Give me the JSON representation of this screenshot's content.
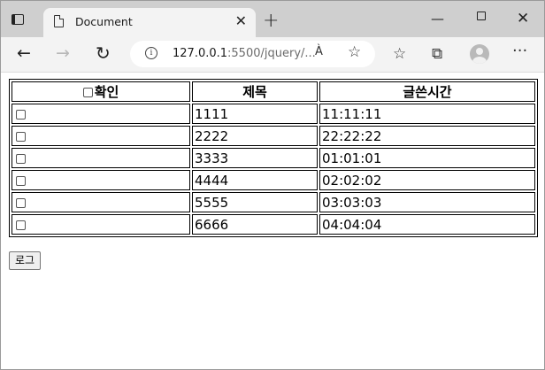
{
  "browser": {
    "tab_title": "Document",
    "url_host": "127.0.0.1",
    "url_rest": ":5500/jquery/...",
    "read_aloud_label": "À",
    "icons": [
      "sidebar-toggle-icon",
      "document-icon",
      "close-icon",
      "plus-icon",
      "minimize-icon",
      "maximize-icon",
      "window-close-icon",
      "back-icon",
      "forward-icon",
      "reload-icon",
      "info-icon",
      "read-aloud-icon",
      "add-favorite-icon",
      "favorites-icon",
      "collections-icon",
      "profile-icon",
      "more-icon"
    ]
  },
  "table": {
    "headers": [
      "확인",
      "제목",
      "글쓴시간"
    ],
    "rows": [
      {
        "title": "1111",
        "time": "11:11:11"
      },
      {
        "title": "2222",
        "time": "22:22:22"
      },
      {
        "title": "3333",
        "time": "01:01:01"
      },
      {
        "title": "4444",
        "time": "02:02:02"
      },
      {
        "title": "5555",
        "time": "03:03:03"
      },
      {
        "title": "6666",
        "time": "04:04:04"
      }
    ]
  },
  "buttons": {
    "log": "로그"
  }
}
